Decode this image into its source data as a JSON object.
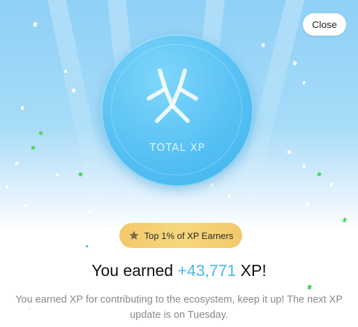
{
  "close_button": {
    "label": "Close"
  },
  "coin": {
    "label": "TOTAL XP",
    "logo_icon": "total-xp-logo-icon"
  },
  "badge": {
    "icon": "star-icon",
    "text": "Top 1% of XP Earners"
  },
  "headline": {
    "prefix": "You earned ",
    "amount": "+43,771",
    "suffix": " XP!"
  },
  "description": "You earned XP for contributing to the ecosystem, keep it up! The next XP update is on Tuesday.",
  "colors": {
    "hero_sky": "#8fd0f6",
    "coin_blue": "#56c1f3",
    "amount_accent": "#47b9ef",
    "badge_gold": "#f2c96a",
    "confetti_green": "#4cd964"
  }
}
